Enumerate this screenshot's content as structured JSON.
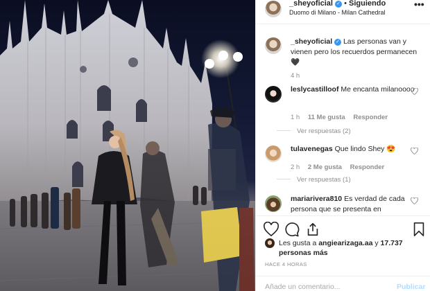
{
  "photo": {
    "alt_subject": "Duomo di Milano"
  },
  "header": {
    "username": "_sheyoficial",
    "separator": "•",
    "follow_status": "Siguiendo",
    "location": "Duomo di Milano - Milan Cathedral",
    "more": "•••"
  },
  "caption": {
    "username": "_sheyoficial",
    "text": "Las personas van y vienen pero los recuerdos permanecen",
    "emoji": "🖤",
    "time": "4 h"
  },
  "comments": [
    {
      "username": "leslycastilloof",
      "text": "Me encanta milanoooo",
      "time": "1 h",
      "likes": "11 Me gusta",
      "reply": "Responder",
      "view_replies": "Ver respuestas (2)"
    },
    {
      "username": "tulavenegas",
      "text": "Que lindo Shey",
      "emoji": "😍",
      "time": "2 h",
      "likes": "2 Me gusta",
      "reply": "Responder",
      "view_replies": "Ver respuestas (1)"
    },
    {
      "username": "mariarivera810",
      "text": "Es verdad de cada persona que se presenta en"
    }
  ],
  "likes": {
    "prefix": "Les gusta a",
    "user": "angiearizaga.aa",
    "suffix": "y",
    "count": "17.737 personas más"
  },
  "posted_ago": "HACE 4 HORAS",
  "add_comment": {
    "placeholder": "Añade un comentario...",
    "post": "Publicar"
  },
  "colors": {
    "verified": "#3897f0",
    "muted": "#8e8e8e",
    "post_disabled": "#b3dbff"
  }
}
